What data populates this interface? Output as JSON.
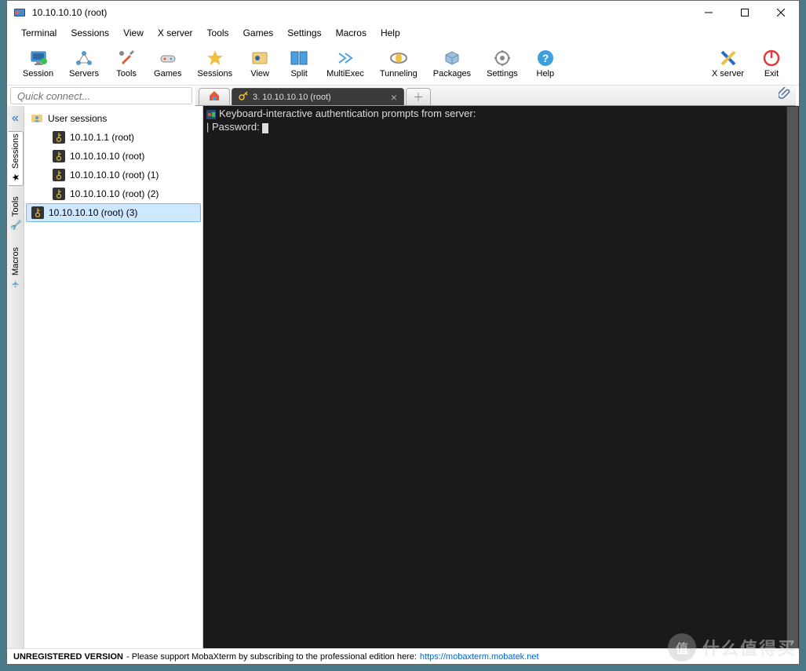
{
  "window": {
    "title": "10.10.10.10 (root)"
  },
  "menu": [
    "Terminal",
    "Sessions",
    "View",
    "X server",
    "Tools",
    "Games",
    "Settings",
    "Macros",
    "Help"
  ],
  "toolbar": {
    "session": "Session",
    "servers": "Servers",
    "tools": "Tools",
    "games": "Games",
    "sessions": "Sessions",
    "view": "View",
    "split": "Split",
    "multiexec": "MultiExec",
    "tunneling": "Tunneling",
    "packages": "Packages",
    "settings": "Settings",
    "help": "Help",
    "xserver": "X server",
    "exit": "Exit"
  },
  "quick": {
    "placeholder": "Quick connect..."
  },
  "tabs": {
    "active_label": "3. 10.10.10.10 (root)"
  },
  "vtabs": {
    "sessions": "Sessions",
    "tools": "Tools",
    "macros": "Macros"
  },
  "tree": {
    "root": "User sessions",
    "items": [
      "10.10.1.1 (root)",
      "10.10.10.10 (root)",
      "10.10.10.10 (root) (1)",
      "10.10.10.10 (root) (2)",
      "10.10.10.10 (root) (3)"
    ]
  },
  "terminal": {
    "line1": "Keyboard-interactive authentication prompts from server:",
    "line2": "| Password: "
  },
  "status": {
    "label": "UNREGISTERED VERSION",
    "text": " -  Please support MobaXterm by subscribing to the professional edition here:  ",
    "link": "https://mobaxterm.mobatek.net"
  },
  "watermark": {
    "badge": "值",
    "text": "什么值得买"
  }
}
